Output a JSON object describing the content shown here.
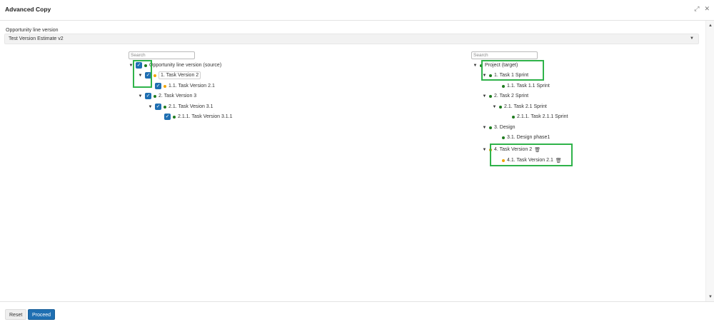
{
  "header": {
    "title": "Advanced Copy",
    "icons": [
      "expand-icon",
      "close-icon"
    ],
    "expand_glyph": "⤢",
    "close_glyph": "✕"
  },
  "version": {
    "label": "Opportunity line version",
    "selected": "Test Version Estimate v2"
  },
  "source_tree": {
    "search_placeholder": "Search",
    "nodes": [
      {
        "label": "Opportunity line version (source)",
        "dot": "green",
        "checked": true,
        "expanded": true
      },
      {
        "label": "1. Task Version 2",
        "dot": "orange",
        "checked": true,
        "expanded": true
      },
      {
        "label": "1.1. Task Version 2.1",
        "dot": "orange",
        "checked": true
      },
      {
        "label": "2. Task Version 3",
        "dot": "green",
        "checked": true,
        "expanded": true
      },
      {
        "label": "2.1. Task Vesion 3.1",
        "dot": "green",
        "checked": true,
        "expanded": true
      },
      {
        "label": "2.1.1. Task Version 3.1.1",
        "dot": "green",
        "checked": true
      }
    ]
  },
  "target_tree": {
    "search_placeholder": "Search",
    "nodes": [
      {
        "label": "Project (target)",
        "dot": "green",
        "expanded": true
      },
      {
        "label": "1. Task 1 Sprint",
        "dot": "green",
        "expanded": true
      },
      {
        "label": "1.1. Task 1.1 Sprint",
        "dot": "green"
      },
      {
        "label": "2. Task 2 Sprint",
        "dot": "green",
        "expanded": true
      },
      {
        "label": "2.1. Task 2.1 Sprint",
        "dot": "green",
        "expanded": true
      },
      {
        "label": "2.1.1. Task 2.1.1 Sprint",
        "dot": "green"
      },
      {
        "label": "3. Design",
        "dot": "green",
        "expanded": true
      },
      {
        "label": "3.1. Design phase1",
        "dot": "green"
      },
      {
        "label": "4. Task Version 2",
        "dot": "orange",
        "expanded": true,
        "deletable": true
      },
      {
        "label": "4.1. Task Version 2.1",
        "dot": "orange",
        "deletable": true
      }
    ]
  },
  "footer": {
    "reset_label": "Reset",
    "proceed_label": "Proceed"
  },
  "colors": {
    "accent": "#1f6fb2",
    "highlight": "#2fb34a",
    "dot_green": "#1e7b1e",
    "dot_orange": "#f0a500"
  }
}
